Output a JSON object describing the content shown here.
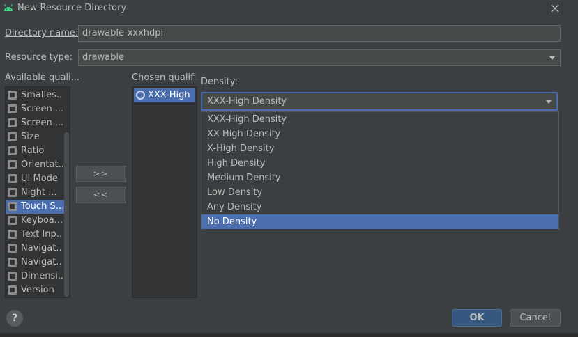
{
  "window": {
    "title": "New Resource Directory",
    "icon": "android-icon",
    "close_icon": "close-icon"
  },
  "form": {
    "directory_name_label": "Directory name:",
    "directory_name_value": "drawable-xxxhdpi",
    "resource_type_label": "Resource type:",
    "resource_type_value": "drawable"
  },
  "available": {
    "label": "Available quali...",
    "items": [
      {
        "label": "Smalles...",
        "icon": "smallest-width-icon"
      },
      {
        "label": "Screen ...",
        "icon": "screen-width-icon"
      },
      {
        "label": "Screen ...",
        "icon": "screen-height-icon"
      },
      {
        "label": "Size",
        "icon": "size-icon"
      },
      {
        "label": "Ratio",
        "icon": "ratio-icon"
      },
      {
        "label": "Orientat...",
        "icon": "orientation-icon"
      },
      {
        "label": "UI Mode",
        "icon": "ui-mode-icon"
      },
      {
        "label": "Night ...",
        "icon": "night-mode-icon"
      },
      {
        "label": "Touch S...",
        "icon": "touch-screen-icon",
        "selected": true
      },
      {
        "label": "Keyboa...",
        "icon": "keyboard-icon"
      },
      {
        "label": "Text Inp...",
        "icon": "text-input-icon"
      },
      {
        "label": "Navigat...",
        "icon": "navigation-state-icon"
      },
      {
        "label": "Navigat...",
        "icon": "navigation-method-icon"
      },
      {
        "label": "Dimensi...",
        "icon": "dimension-icon"
      },
      {
        "label": "Version",
        "icon": "version-icon"
      }
    ]
  },
  "buttons": {
    "add": ">>",
    "remove": "<<",
    "ok": "OK",
    "cancel": "Cancel",
    "help": "?"
  },
  "chosen": {
    "label": "Chosen qualifi...",
    "items": [
      {
        "label": "XXX-High ...",
        "icon": "density-icon"
      }
    ]
  },
  "density": {
    "label": "Density:",
    "selected": "XXX-High Density",
    "options": [
      "XXX-High Density",
      "XX-High Density",
      "X-High Density",
      "High Density",
      "Medium Density",
      "Low Density",
      "Any Density",
      "No Density"
    ],
    "highlighted_option": "No Density"
  },
  "colors": {
    "background": "#3c3f41",
    "selection": "#4b6eaf",
    "ok_button": "#365880",
    "android_green": "#3ddc84"
  }
}
